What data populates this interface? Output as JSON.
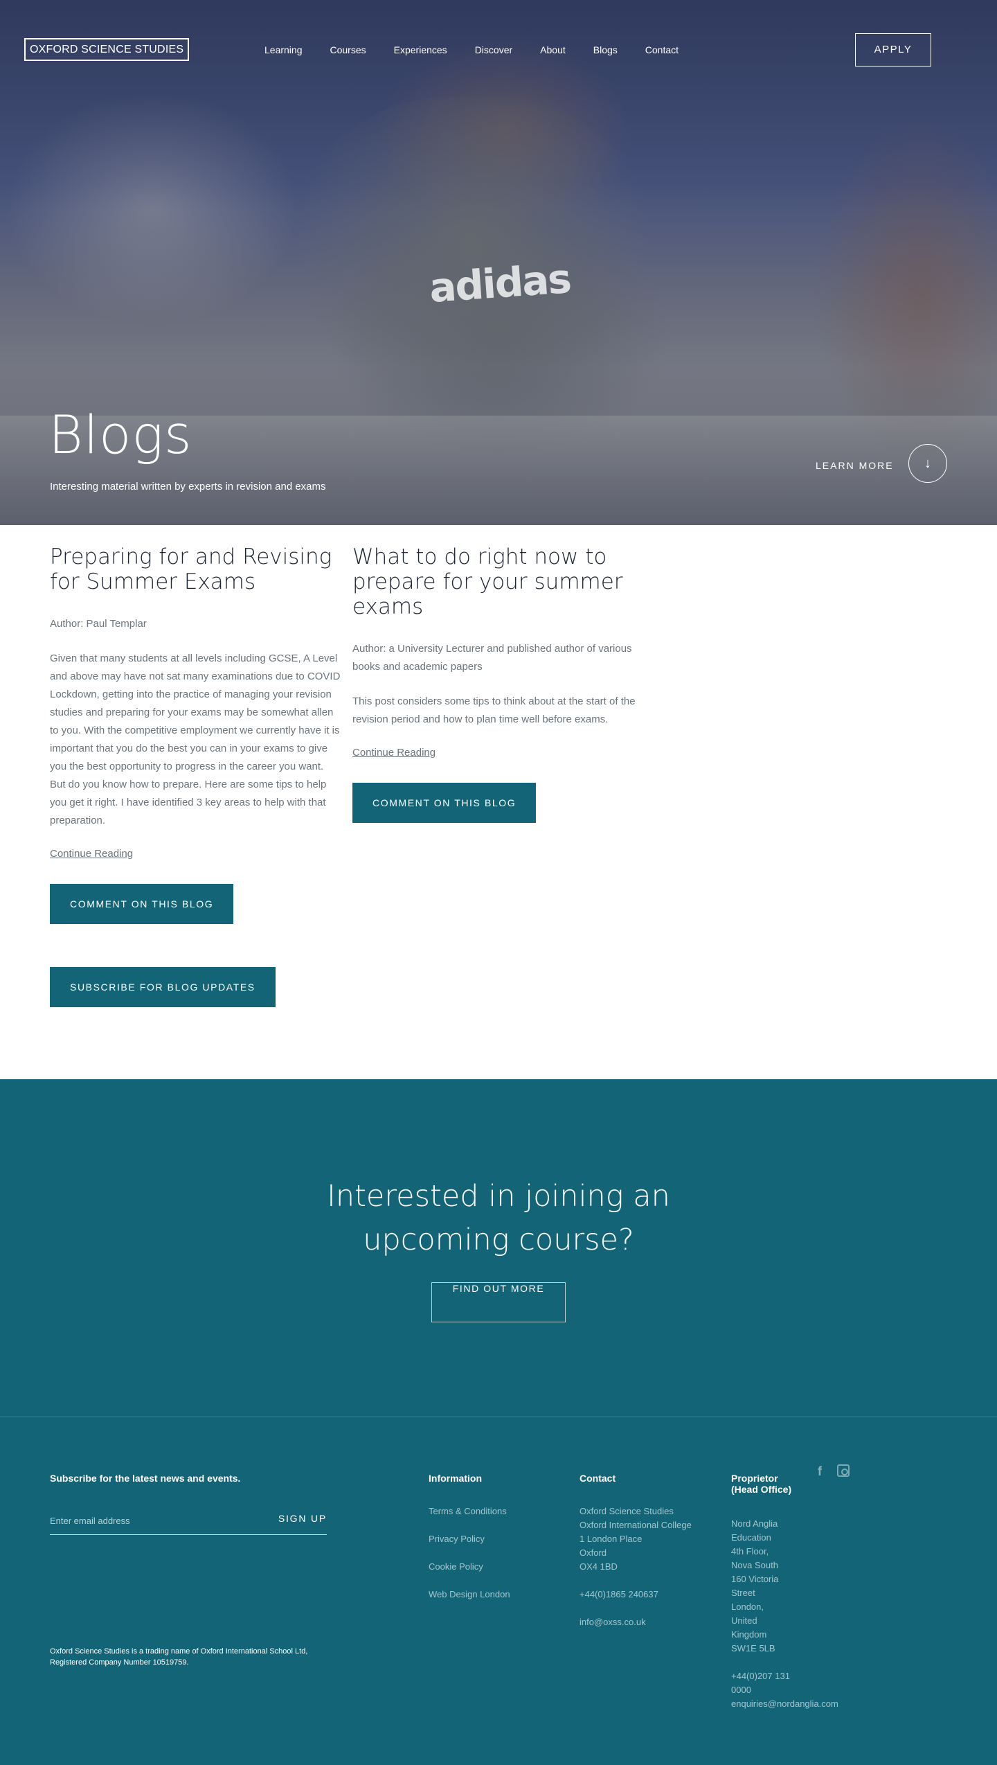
{
  "nav": {
    "logo": "OXFORD SCIENCE STUDIES",
    "items": [
      "Learning",
      "Courses",
      "Experiences",
      "Discover",
      "About",
      "Blogs",
      "Contact"
    ],
    "apply": "APPLY"
  },
  "hero": {
    "title": "Blogs",
    "subtitle": "Interesting material written by experts in revision and exams",
    "learn_more": "LEARN MORE",
    "learn_more_icon": "arrow-down-icon",
    "photo_print": "adidas"
  },
  "posts": [
    {
      "title": "Preparing for and Revising for Summer Exams",
      "author": "Author: Paul Templar",
      "body": "Given that many students at all levels including GCSE, A Level and above may have not sat many examinations due to COVID Lockdown, getting into the practice of managing your revision studies and preparing for your exams may be somewhat allen to you.  With the competitive employment we currently have it is important that you do the best you can in your exams to give you the best opportunity to progress in the career you want.  But do you know how to prepare.  Here are some tips to help you get it right.  I have identified 3 key areas to help with that preparation.",
      "continue": "Continue Reading",
      "comment": "COMMENT ON THIS BLOG"
    },
    {
      "title": "What to do right now to prepare for your summer exams",
      "author": "Author: a University Lecturer and published author of various books and academic papers",
      "body": "This post considers some tips to think about at the start of the revision period and how to plan time well before exams.",
      "continue": "Continue Reading",
      "comment": "COMMENT ON THIS BLOG"
    }
  ],
  "subscribe_blog": "SUBSCRIBE FOR BLOG UPDATES",
  "cta": {
    "title_line1": "Interested in joining an",
    "title_line2": "upcoming course?",
    "button": "FIND OUT MORE"
  },
  "footer": {
    "subscribe_heading": "Subscribe for the latest news and events.",
    "email_placeholder": "Enter email address",
    "signup": "SIGN UP",
    "legal_line1": "Oxford Science Studies is a trading name of Oxford International School Ltd,",
    "legal_line2": "Registered Company Number 10519759.",
    "information": {
      "heading": "Information",
      "links": [
        "Terms & Conditions",
        "Privacy Policy",
        "Cookie Policy",
        "Web Design London"
      ]
    },
    "contact": {
      "heading": "Contact",
      "address": [
        "Oxford Science Studies",
        "Oxford International College",
        "1 London Place",
        "Oxford",
        "OX4 1BD"
      ],
      "phone": "+44(0)1865 240637",
      "email": "info@oxss.co.uk"
    },
    "proprietor": {
      "heading_line1": "Proprietor",
      "heading_line2": "(Head Office)",
      "address": [
        "Nord Anglia",
        "Education",
        "4th Floor,",
        "Nova South",
        "160 Victoria",
        "Street",
        "London,",
        "United",
        "Kingdom",
        "SW1E 5LB"
      ],
      "phone_line1": "+44(0)207 131",
      "phone_line2": "0000",
      "email": "enquiries@nordanglia.com"
    },
    "social": {
      "facebook_icon": "facebook-icon",
      "facebook_glyph": "f",
      "instagram_icon": "instagram-icon"
    }
  },
  "colors": {
    "teal": "#136477",
    "heading_dark": "#1e2534",
    "body_text": "#6b747b"
  }
}
